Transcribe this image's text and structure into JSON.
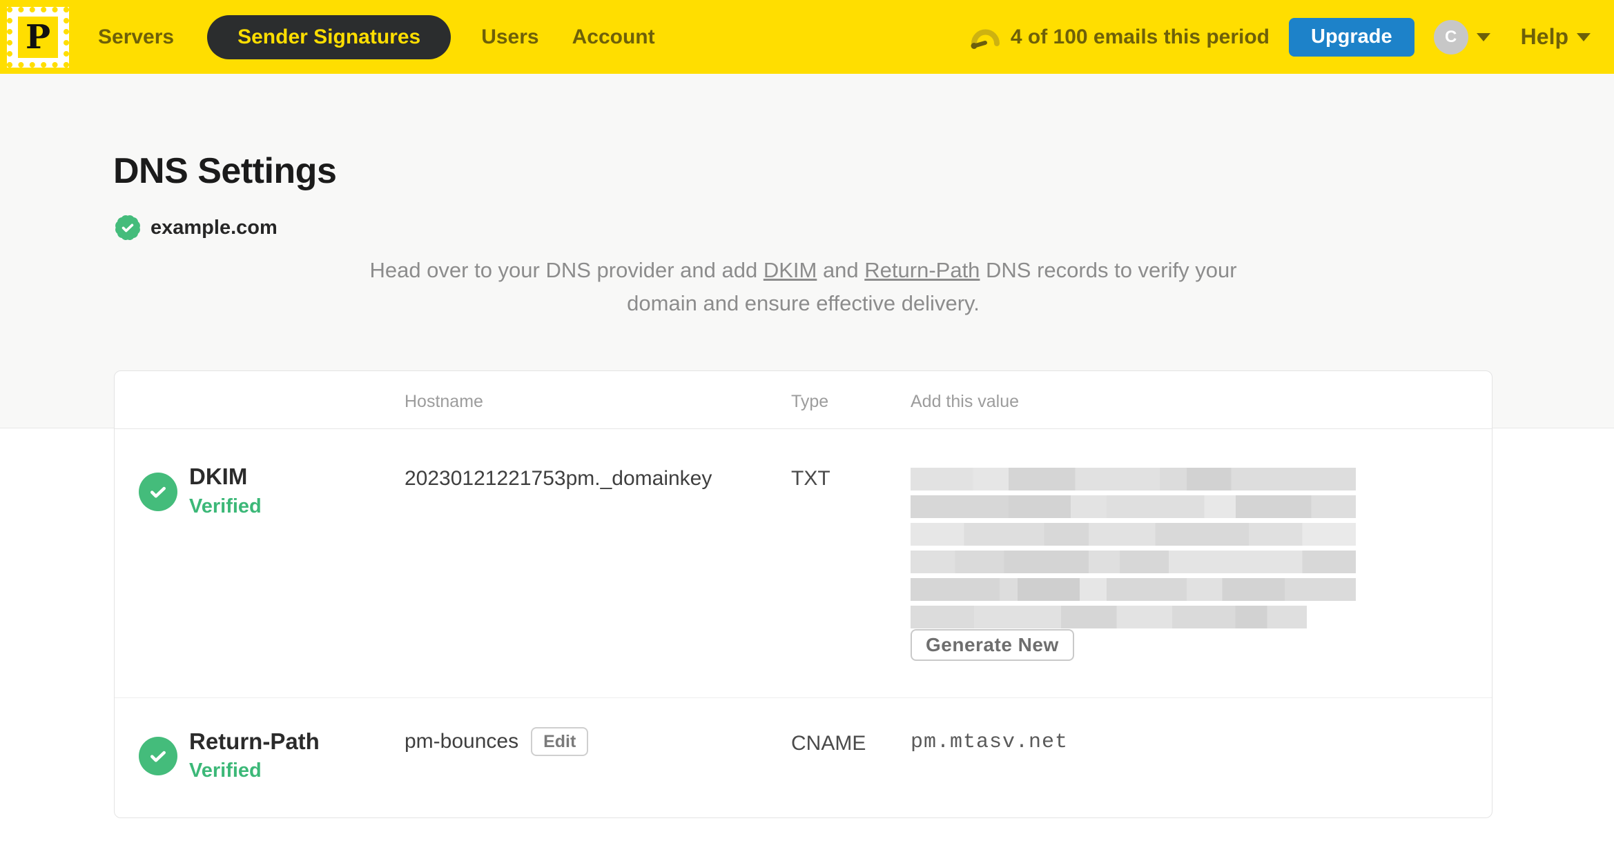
{
  "header": {
    "logo_letter": "P",
    "nav": [
      {
        "label": "Servers",
        "active": false
      },
      {
        "label": "Sender Signatures",
        "active": true
      },
      {
        "label": "Users",
        "active": false
      },
      {
        "label": "Account",
        "active": false
      }
    ],
    "usage_text": "4 of 100 emails this period",
    "upgrade_label": "Upgrade",
    "avatar_initial": "C",
    "help_label": "Help"
  },
  "page": {
    "title": "DNS Settings",
    "domain": "example.com",
    "intro": {
      "pre": "Head over to your DNS provider and add ",
      "link_dkim": "DKIM",
      "mid": " and ",
      "link_return_path": "Return-Path",
      "post": " DNS records to verify your domain and ensure effective delivery."
    }
  },
  "table": {
    "headers": {
      "hostname": "Hostname",
      "type": "Type",
      "value": "Add this value"
    },
    "rows": [
      {
        "name": "DKIM",
        "status": "Verified",
        "hostname": "20230121221753pm._domainkey",
        "type": "TXT",
        "value_redacted": true,
        "action_label": "Generate New"
      },
      {
        "name": "Return-Path",
        "status": "Verified",
        "hostname": "pm-bounces",
        "edit_label": "Edit",
        "type": "CNAME",
        "value": "pm.mtasv.net"
      }
    ]
  },
  "colors": {
    "brand_yellow": "#FFDE00",
    "nav_olive": "#6E6009",
    "active_pill": "#2B2D2E",
    "upgrade_blue": "#1D82C9",
    "verified_green": "#3CB878",
    "check_circle_green": "#44BC7B",
    "page_bg": "#F8F8F7"
  }
}
